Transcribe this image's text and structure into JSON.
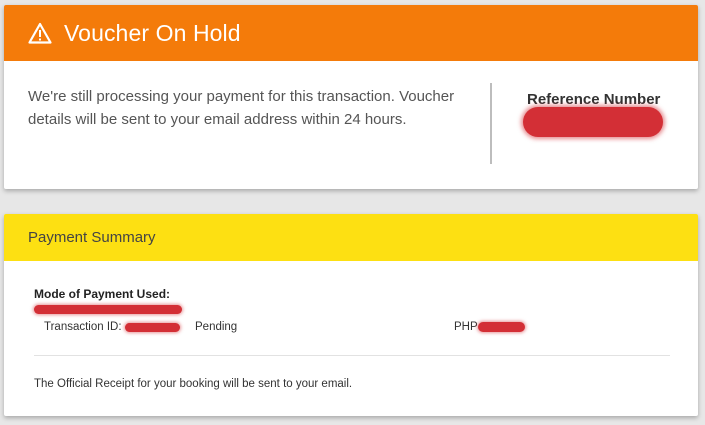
{
  "hold": {
    "title": "Voucher On Hold",
    "icon": "warning-triangle-icon",
    "message": "We're still processing your payment for this transaction. Voucher details will be sent to your email address within 24 hours.",
    "reference_label": "Reference Number",
    "reference_value": "[redacted]"
  },
  "summary": {
    "title": "Payment Summary",
    "mode_label": "Mode of Payment Used:",
    "mode_value": "[redacted]",
    "transaction_label": "Transaction ID:",
    "transaction_value": "[redacted]",
    "status": "Pending",
    "currency": "PHP",
    "amount": "[redacted]",
    "receipt_note": "The Official Receipt for your booking will be sent to your email."
  },
  "colors": {
    "header_orange": "#f47b0a",
    "header_yellow": "#fde012",
    "redaction": "#d32f36",
    "background": "#e7e7e7"
  }
}
